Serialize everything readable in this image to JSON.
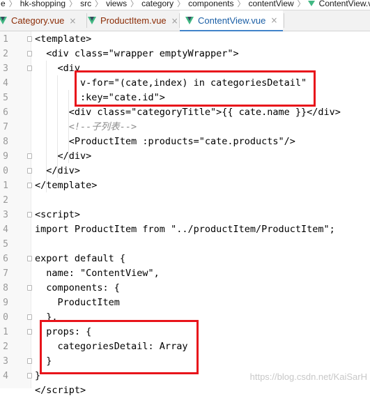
{
  "breadcrumb": {
    "items": [
      "e",
      "hk-shopping",
      "src",
      "views",
      "category",
      "components",
      "contentView"
    ],
    "file": "ContentView.vu"
  },
  "tabs": [
    {
      "label": "Category.vue",
      "active": false
    },
    {
      "label": "ProductItem.vue",
      "active": false
    },
    {
      "label": "ContentView.vue",
      "active": true
    }
  ],
  "close_glyph": "×",
  "gutter": {
    "line_numbers": [
      "1",
      "2",
      "3",
      "4",
      "5",
      "6",
      "7",
      "8",
      "9",
      "0",
      "1",
      "2",
      "3",
      "4",
      "5",
      "6",
      "7",
      "8",
      "9",
      "0",
      "1",
      "2",
      "3",
      "4"
    ]
  },
  "code_lines": [
    "<template>",
    "  <div class=\"wrapper emptyWrapper\">",
    "    <div",
    "        v-for=\"(cate,index) in categoriesDetail\"",
    "        :key=\"cate.id\">",
    "      <div class=\"categoryTitle\">{{ cate.name }}</div>",
    "      <!--子列表-->",
    "      <ProductItem :products=\"cate.products\"/>",
    "    </div>",
    "  </div>",
    "</template>",
    "",
    "<script>",
    "import ProductItem from \"../productItem/ProductItem\";",
    "",
    "export default {",
    "  name: \"ContentView\",",
    "  components: {",
    "    ProductItem",
    "  },",
    "  props: {",
    "    categoriesDetail: Array",
    "  }",
    "}",
    "</script>"
  ],
  "watermark": "https://blog.csdn.net/KaiSarH",
  "colors": {
    "highlight_box": "#e8141b",
    "tab_active_text": "#1b5fa6",
    "tab_inactive_text": "#8b2c06",
    "vue_green": "#41b883"
  }
}
